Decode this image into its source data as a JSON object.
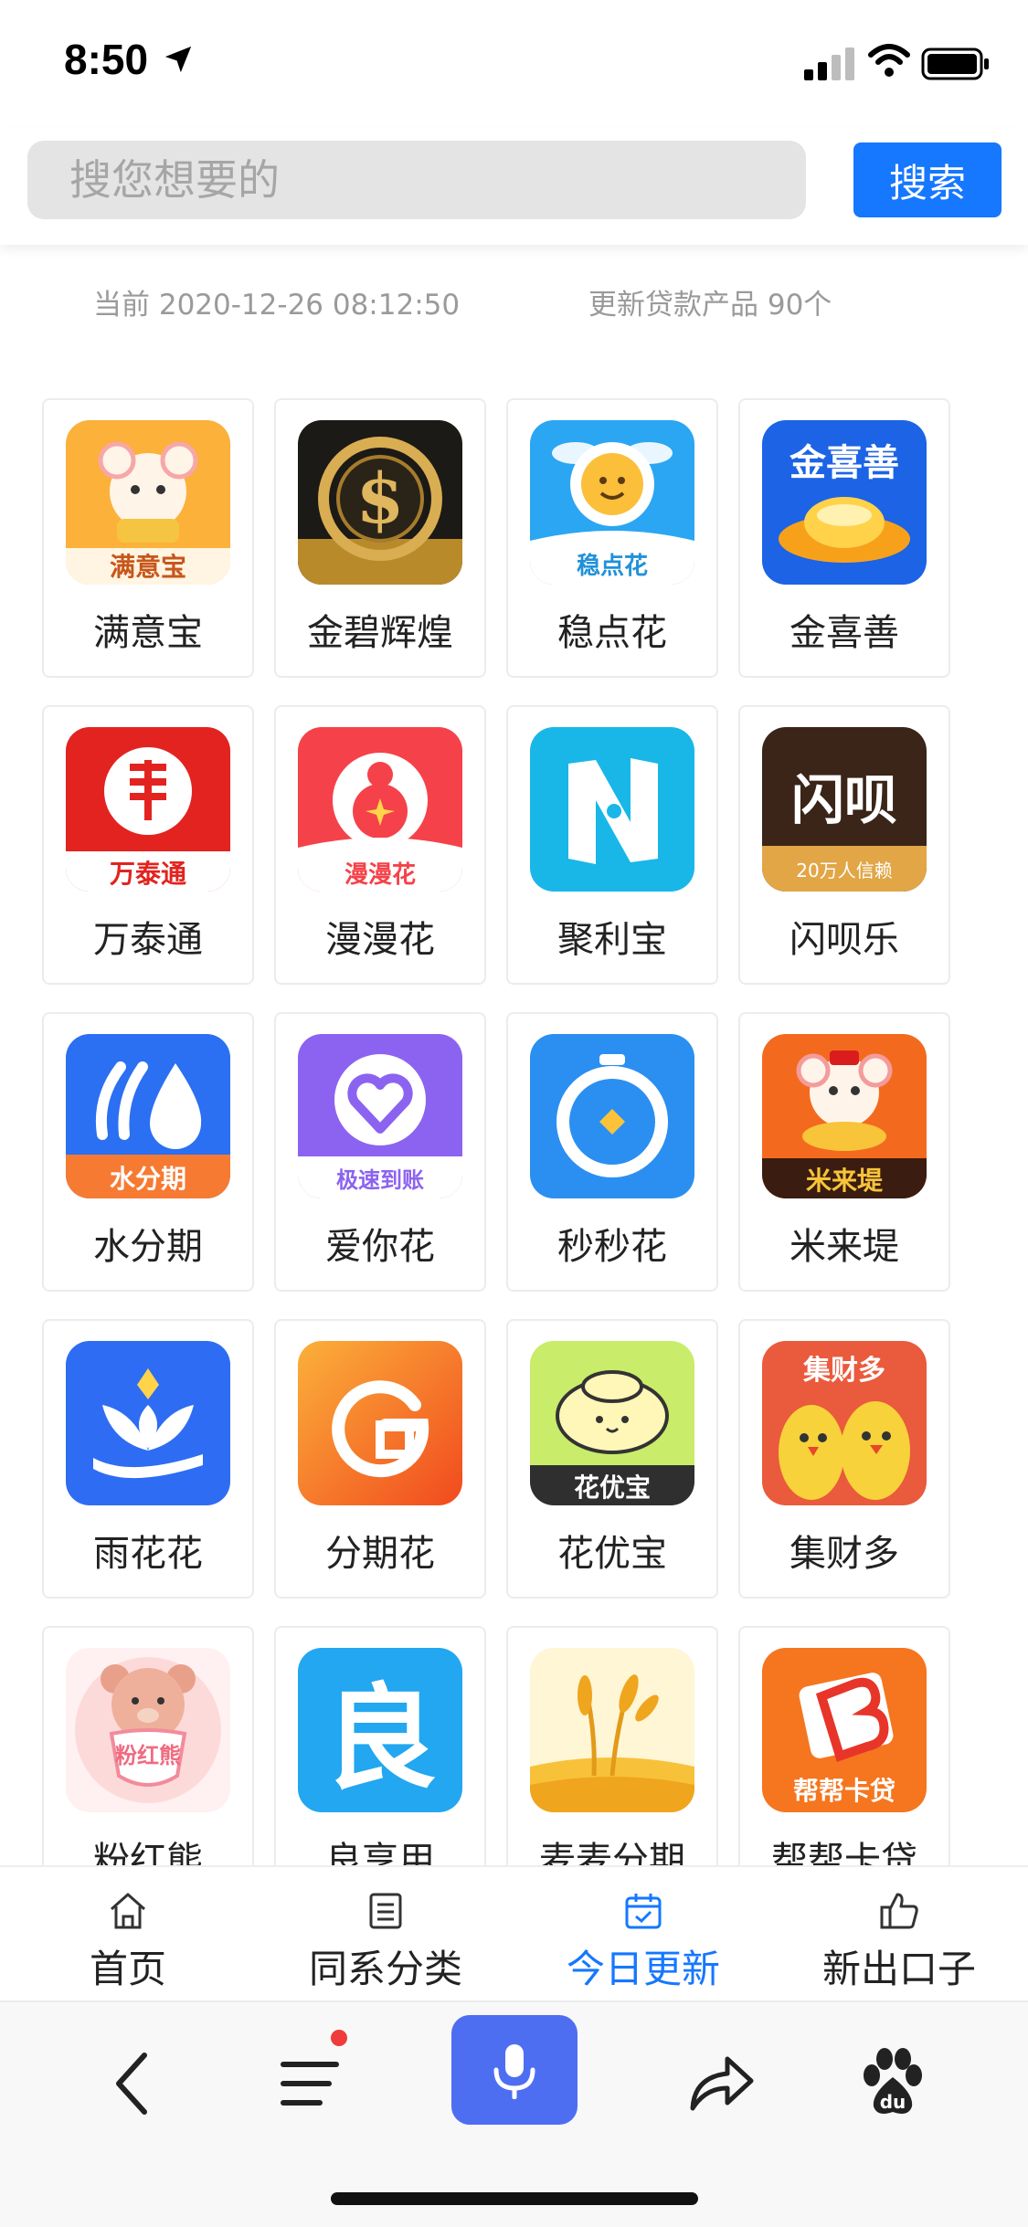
{
  "status": {
    "time": "8:50"
  },
  "search": {
    "placeholder": "搜您想要的",
    "button_label": "搜索"
  },
  "info": {
    "current_time": "当前 2020-12-26 08:12:50",
    "update_count": "更新贷款产品 90个"
  },
  "apps": [
    {
      "name": "满意宝",
      "icon_label": "满意宝",
      "icon": "mouse-mascot-icon"
    },
    {
      "name": "金碧辉煌",
      "icon_label": "",
      "icon": "gold-dollar-coin-icon"
    },
    {
      "name": "稳点花",
      "icon_label": "稳点花",
      "icon": "winged-coin-icon"
    },
    {
      "name": "金喜善",
      "icon_label": "金喜善",
      "icon": "gold-ingot-icon"
    },
    {
      "name": "万泰通",
      "icon_label": "万泰通",
      "icon": "red-seal-icon"
    },
    {
      "name": "漫漫花",
      "icon_label": "漫漫花",
      "icon": "money-bag-icon"
    },
    {
      "name": "聚利宝",
      "icon_label": "",
      "icon": "letter-n-icon"
    },
    {
      "name": "闪呗乐",
      "icon_label": "闪呗",
      "icon_sub": "20万人信赖",
      "icon": "shanbei-logo-icon"
    },
    {
      "name": "水分期",
      "icon_label": "水分期",
      "icon": "water-drop-icon"
    },
    {
      "name": "爱你花",
      "icon_label": "极速到账",
      "icon": "heart-icon"
    },
    {
      "name": "秒秒花",
      "icon_label": "",
      "icon": "stopwatch-icon"
    },
    {
      "name": "米来堤",
      "icon_label": "米来堤",
      "icon": "mouse-gold-icon"
    },
    {
      "name": "雨花花",
      "icon_label": "",
      "icon": "lotus-hand-icon"
    },
    {
      "name": "分期花",
      "icon_label": "",
      "icon": "circular-g-icon"
    },
    {
      "name": "花优宝",
      "icon_label": "花优宝",
      "icon": "ingot-face-icon"
    },
    {
      "name": "集财多",
      "icon_label": "集财多",
      "icon": "chicks-icon"
    },
    {
      "name": "粉红熊",
      "icon_label": "粉红熊",
      "icon": "pink-bear-icon"
    },
    {
      "name": "良享用",
      "icon_label": "",
      "icon": "liang-character-icon"
    },
    {
      "name": "麦麦分期",
      "icon_label": "",
      "icon": "wheat-icon"
    },
    {
      "name": "帮帮卡贷",
      "icon_label": "帮帮卡贷",
      "icon": "card-b-icon"
    }
  ],
  "tabs": [
    {
      "label": "首页",
      "icon": "home-icon",
      "active": false
    },
    {
      "label": "同系分类",
      "icon": "list-doc-icon",
      "active": false
    },
    {
      "label": "今日更新",
      "icon": "calendar-check-icon",
      "active": true
    },
    {
      "label": "新出口子",
      "icon": "thumbs-up-icon",
      "active": false
    }
  ],
  "colors": {
    "accent": "#1677ff",
    "voice": "#4e6ef2"
  }
}
